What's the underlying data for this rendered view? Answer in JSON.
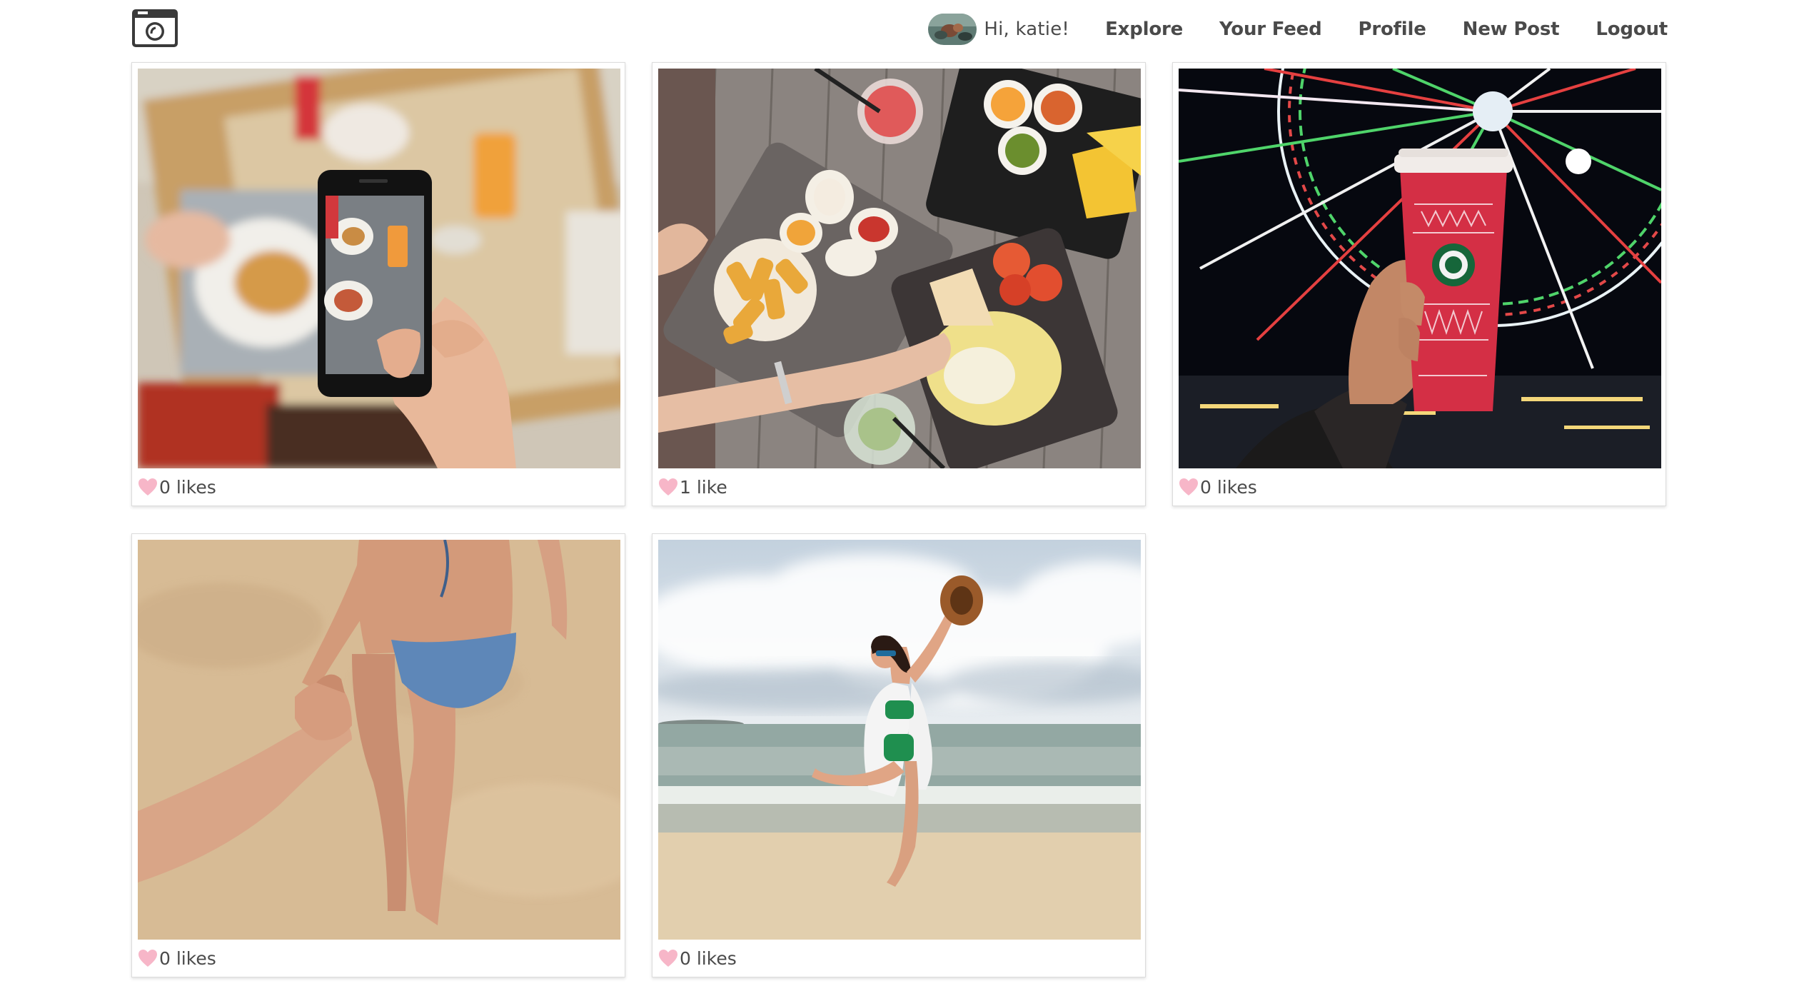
{
  "navbar": {
    "logo_icon": "camera-icon",
    "greeting": "Hi, katie!",
    "links": [
      {
        "label": "Explore"
      },
      {
        "label": "Your Feed"
      },
      {
        "label": "Profile"
      },
      {
        "label": "New Post"
      },
      {
        "label": "Logout"
      }
    ]
  },
  "posts": [
    {
      "likes_label": "0 likes",
      "likes": 0,
      "image_subject": "phone photographing breakfast"
    },
    {
      "likes_label": "1 like",
      "likes": 1,
      "image_subject": "food platters on wooden table"
    },
    {
      "likes_label": "0 likes",
      "likes": 0,
      "image_subject": "red coffee cup in front of ferris wheel"
    },
    {
      "likes_label": "0 likes",
      "likes": 0,
      "image_subject": "holding hands on beach"
    },
    {
      "likes_label": "0 likes",
      "likes": 0,
      "image_subject": "woman jumping on beach"
    }
  ],
  "colors": {
    "text": "#4a4a4a",
    "heart": "#f7b6c8",
    "card_border": "#dcdcdc",
    "background": "#ffffff"
  }
}
